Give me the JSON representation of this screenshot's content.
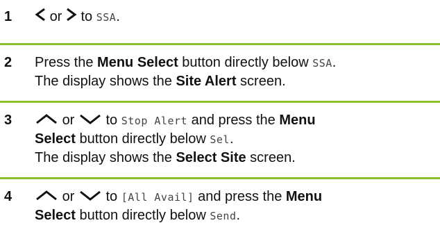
{
  "steps": [
    {
      "number": "1",
      "or": "or",
      "to": "to",
      "target": "SSA",
      "period": "."
    },
    {
      "number": "2",
      "line1_a": "Press the ",
      "button_name": "Menu Select",
      "line1_b": " button directly below ",
      "target": "SSA",
      "period": ".",
      "line2_a": "The display shows the ",
      "screen_name": "Site Alert",
      "line2_b": " screen."
    },
    {
      "number": "3",
      "or": "or",
      "to": "to",
      "target": "Stop Alert",
      "and_press": " and press the ",
      "button_name_1": "Menu",
      "button_name_2": "Select",
      "line2_b": " button directly below ",
      "target2": "Sel",
      "period": ".",
      "line3_a": "The display shows the ",
      "screen_name": "Select Site",
      "line3_b": " screen."
    },
    {
      "number": "4",
      "or": "or",
      "to": "to",
      "target": "[All Avail]",
      "and_press": " and press the ",
      "button_name_1": "Menu",
      "button_name_2": "Select",
      "line2_b": " button directly below ",
      "target2": "Send",
      "period": "."
    }
  ],
  "colors": {
    "separator": "#8fbf2e",
    "text": "#111111",
    "display_text": "#444444"
  },
  "icons": [
    "chevron-left-icon",
    "chevron-right-icon",
    "chevron-up-icon",
    "chevron-down-icon"
  ]
}
